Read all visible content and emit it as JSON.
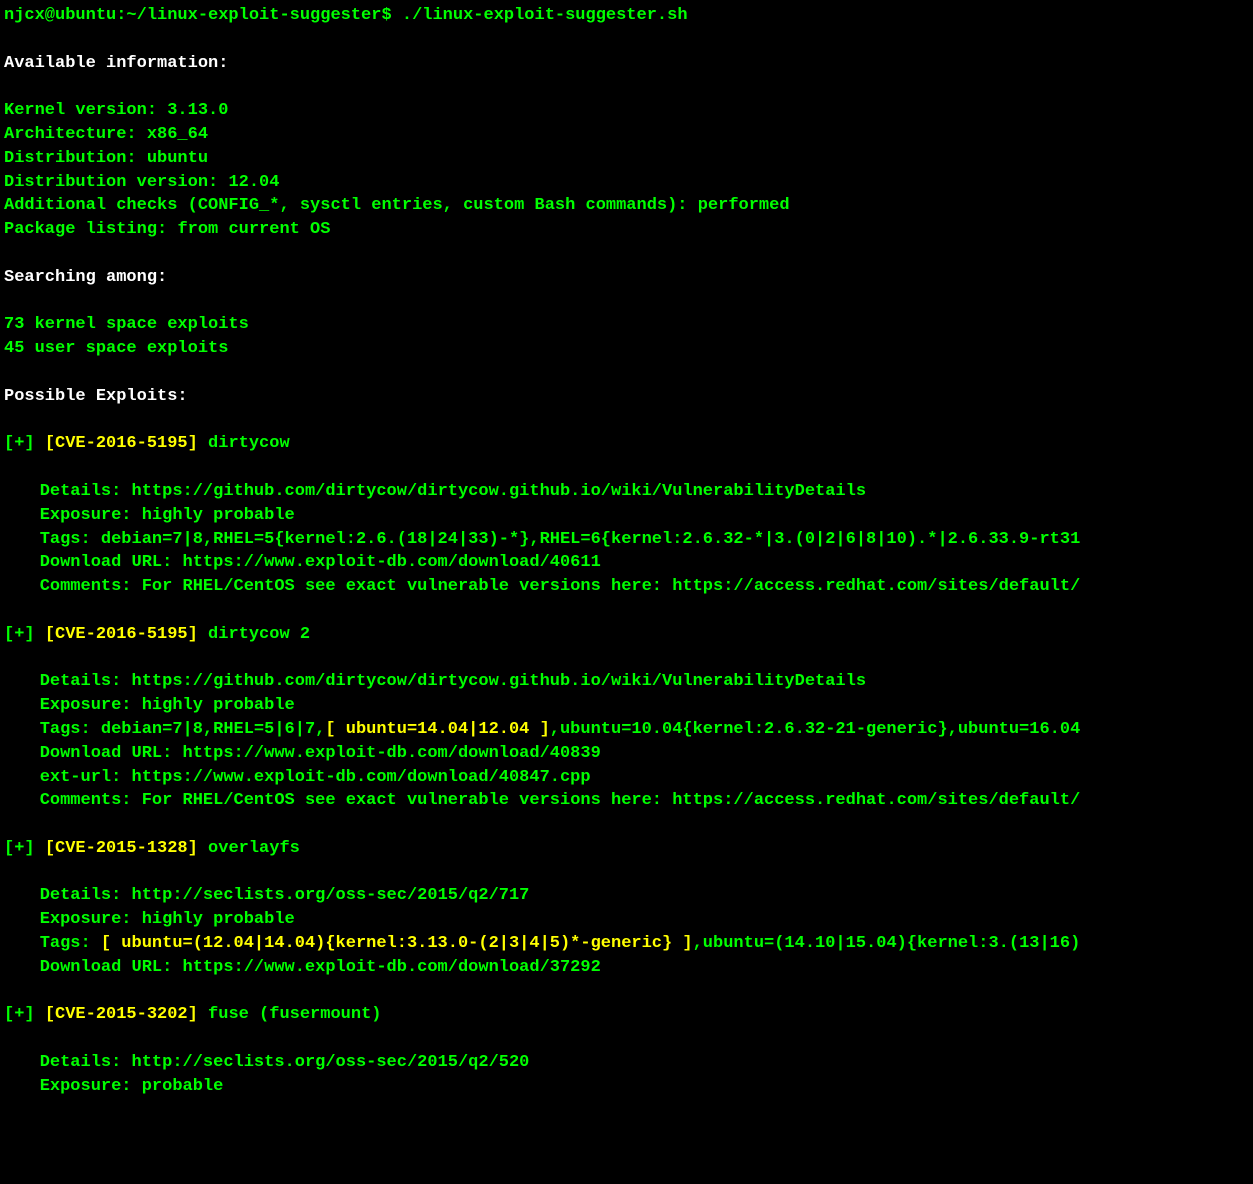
{
  "prompt": {
    "user_host_path": "njcx@ubuntu:~/linux-exploit-suggester$",
    "command": "./linux-exploit-suggester.sh"
  },
  "headers": {
    "available_info": "Available information:",
    "searching": "Searching among:",
    "possible_exploits": "Possible Exploits:"
  },
  "info": {
    "kernel_label": "Kernel version: ",
    "kernel_value": "3.13.0",
    "arch_label": "Architecture: ",
    "arch_value": "x86_64",
    "dist_label": "Distribution: ",
    "dist_value": "ubuntu",
    "distver_label": "Distribution version: ",
    "distver_value": "12.04",
    "checks_label": "Additional checks (CONFIG_*, sysctl entries, custom Bash commands): ",
    "checks_value": "performed",
    "pkg_label": "Package listing: ",
    "pkg_value": "from current OS"
  },
  "search": {
    "kernel_space": "73 kernel space exploits",
    "user_space": "45 user space exploits"
  },
  "exploits": [
    {
      "marker": "[+] ",
      "cve": "[CVE-2016-5195]",
      "name": " dirtycow",
      "details_label": "Details: ",
      "details_value": "https://github.com/dirtycow/dirtycow.github.io/wiki/VulnerabilityDetails",
      "exposure_label": "Exposure: ",
      "exposure_value": "highly probable",
      "tags_label": "Tags: ",
      "tags_value": "debian=7|8,RHEL=5{kernel:2.6.(18|24|33)-*},RHEL=6{kernel:2.6.32-*|3.(0|2|6|8|10).*|2.6.33.9-rt31",
      "download_label": "Download URL: ",
      "download_value": "https://www.exploit-db.com/download/40611",
      "comments_label": "Comments: ",
      "comments_value": "For RHEL/CentOS see exact vulnerable versions here: https://access.redhat.com/sites/default/"
    },
    {
      "marker": "[+] ",
      "cve": "[CVE-2016-5195]",
      "name": " dirtycow 2",
      "details_label": "Details: ",
      "details_value": "https://github.com/dirtycow/dirtycow.github.io/wiki/VulnerabilityDetails",
      "exposure_label": "Exposure: ",
      "exposure_value": "highly probable",
      "tags_label": "Tags: ",
      "tags_pre": "debian=7|8,RHEL=5|6|7,",
      "tags_highlight": "[ ubuntu=14.04|12.04 ]",
      "tags_post": ",ubuntu=10.04{kernel:2.6.32-21-generic},ubuntu=16.04",
      "download_label": "Download URL: ",
      "download_value": "https://www.exploit-db.com/download/40839",
      "exturl_label": "ext-url: ",
      "exturl_value": "https://www.exploit-db.com/download/40847.cpp",
      "comments_label": "Comments: ",
      "comments_value": "For RHEL/CentOS see exact vulnerable versions here: https://access.redhat.com/sites/default/"
    },
    {
      "marker": "[+] ",
      "cve": "[CVE-2015-1328]",
      "name": " overlayfs",
      "details_label": "Details: ",
      "details_value": "http://seclists.org/oss-sec/2015/q2/717",
      "exposure_label": "Exposure: ",
      "exposure_value": "highly probable",
      "tags_label": "Tags: ",
      "tags_highlight": "[ ubuntu=(12.04|14.04){kernel:3.13.0-(2|3|4|5)*-generic} ]",
      "tags_post": ",ubuntu=(14.10|15.04){kernel:3.(13|16)",
      "download_label": "Download URL: ",
      "download_value": "https://www.exploit-db.com/download/37292"
    },
    {
      "marker": "[+] ",
      "cve": "[CVE-2015-3202]",
      "name": " fuse (fusermount)",
      "details_label": "Details: ",
      "details_value": "http://seclists.org/oss-sec/2015/q2/520",
      "exposure_label": "Exposure: ",
      "exposure_value": "probable"
    }
  ]
}
